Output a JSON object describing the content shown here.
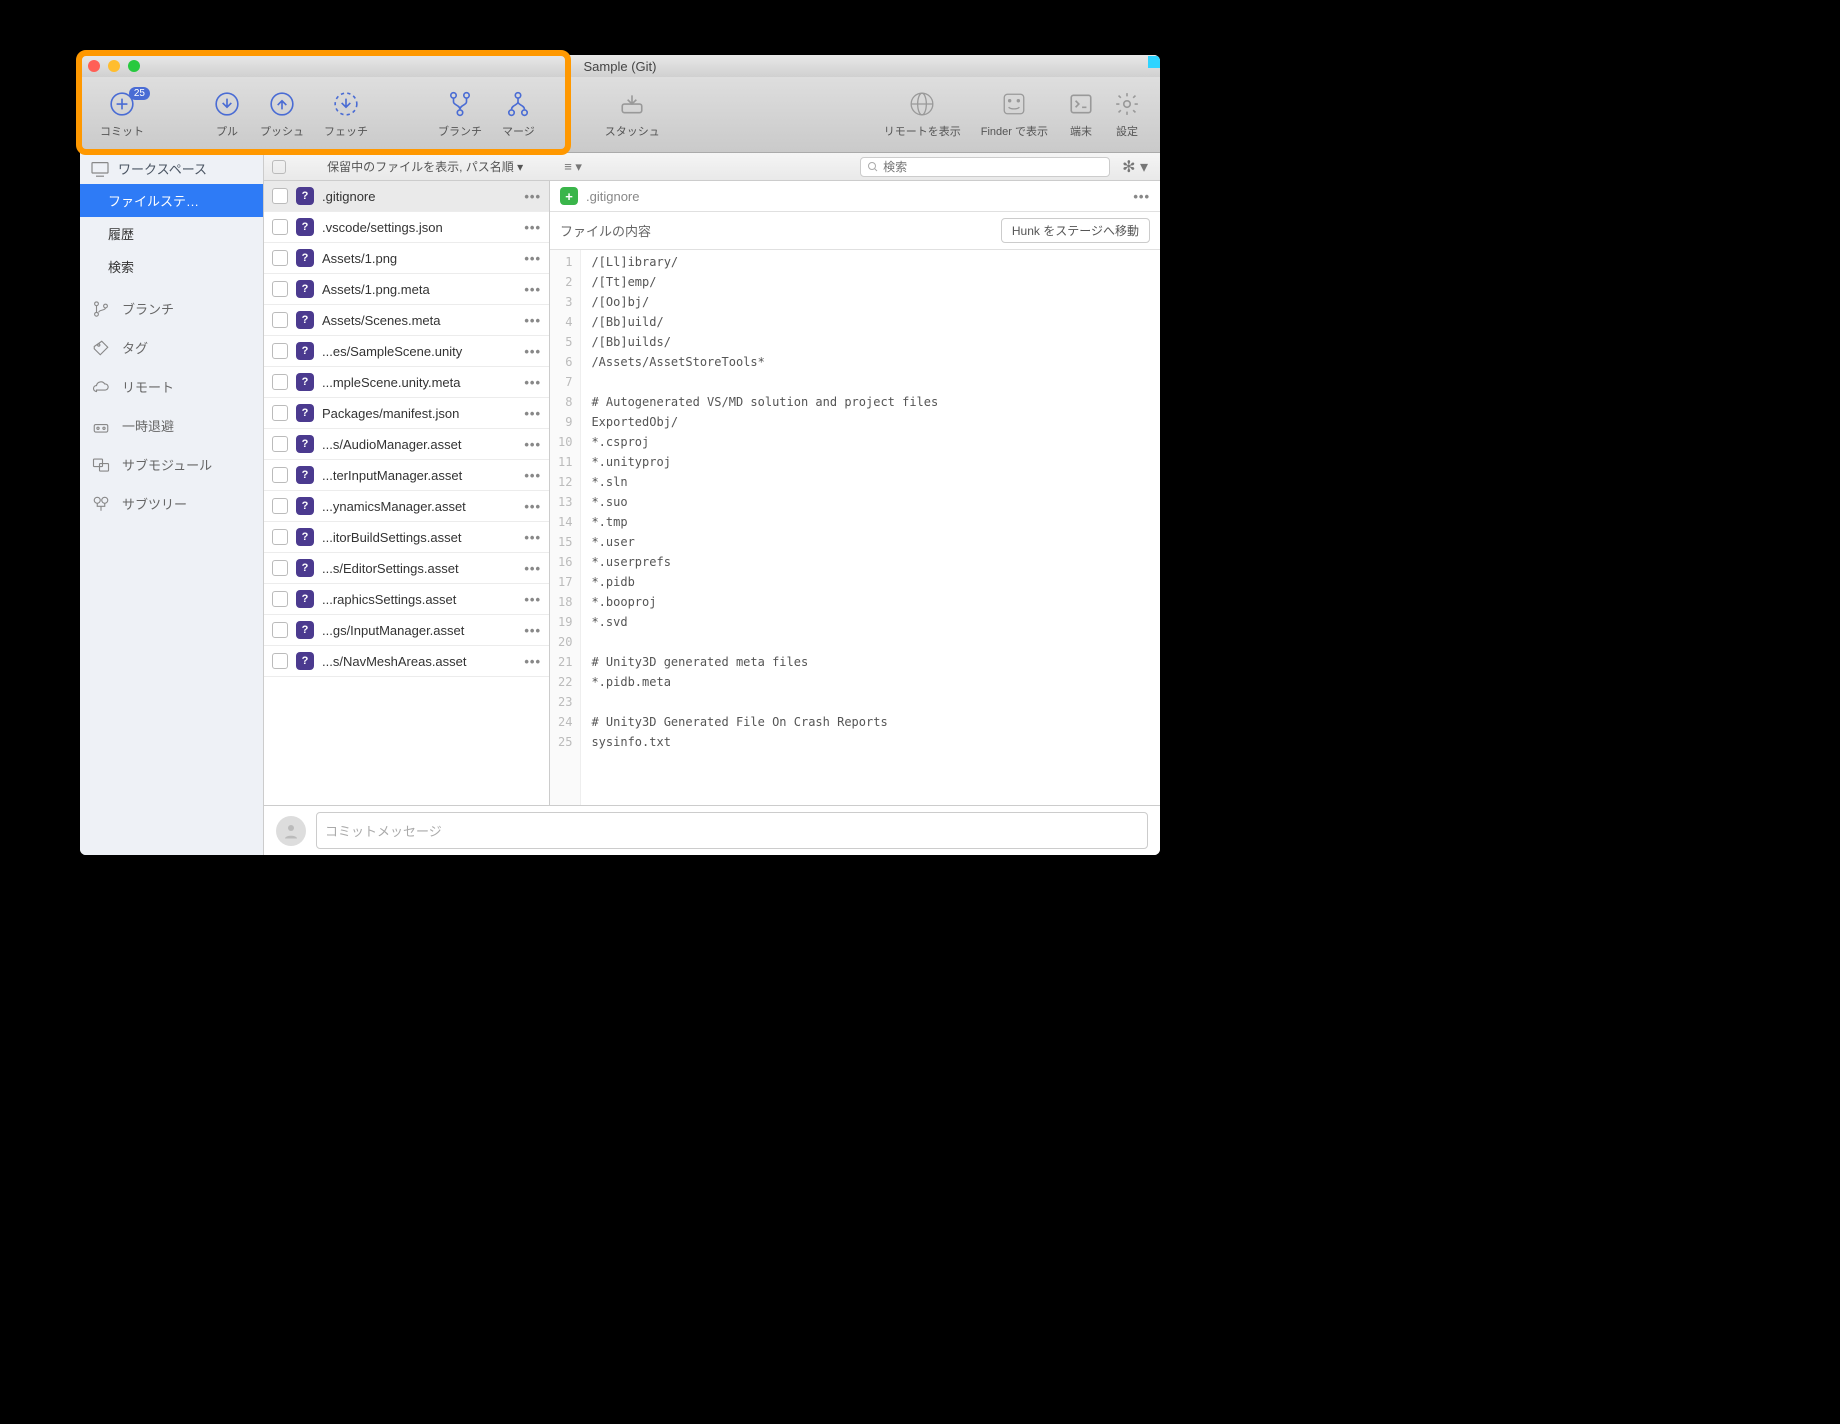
{
  "window_title": "Sample (Git)",
  "toolbar": {
    "commit": {
      "label": "コミット",
      "badge": "25"
    },
    "pull": {
      "label": "プル"
    },
    "push": {
      "label": "プッシュ"
    },
    "fetch": {
      "label": "フェッチ"
    },
    "branch": {
      "label": "ブランチ"
    },
    "merge": {
      "label": "マージ"
    },
    "stash": {
      "label": "スタッシュ"
    },
    "remote": {
      "label": "リモートを表示"
    },
    "finder": {
      "label": "Finder で表示"
    },
    "terminal": {
      "label": "端末"
    },
    "settings": {
      "label": "設定"
    }
  },
  "sidebar": {
    "workspace": "ワークスペース",
    "filestatus": "ファイルステ…",
    "history": "履歴",
    "search": "検索",
    "branches": "ブランチ",
    "tags": "タグ",
    "remotes": "リモート",
    "stashes": "一時退避",
    "submodules": "サブモジュール",
    "subtrees": "サブツリー"
  },
  "filter": {
    "dropdown": "保留中のファイルを表示, パス名順",
    "search_placeholder": "検索"
  },
  "files": [
    {
      "name": ".gitignore",
      "selected": true
    },
    {
      "name": ".vscode/settings.json"
    },
    {
      "name": "Assets/1.png"
    },
    {
      "name": "Assets/1.png.meta"
    },
    {
      "name": "Assets/Scenes.meta"
    },
    {
      "name": "...es/SampleScene.unity"
    },
    {
      "name": "...mpleScene.unity.meta"
    },
    {
      "name": "Packages/manifest.json"
    },
    {
      "name": "...s/AudioManager.asset"
    },
    {
      "name": "...terInputManager.asset"
    },
    {
      "name": "...ynamicsManager.asset"
    },
    {
      "name": "...itorBuildSettings.asset"
    },
    {
      "name": "...s/EditorSettings.asset"
    },
    {
      "name": "...raphicsSettings.asset"
    },
    {
      "name": "...gs/InputManager.asset"
    },
    {
      "name": "...s/NavMeshAreas.asset"
    }
  ],
  "diff": {
    "filename": ".gitignore",
    "content_title": "ファイルの内容",
    "hunk_button": "Hunk をステージへ移動",
    "lines": [
      "/[Ll]ibrary/",
      "/[Tt]emp/",
      "/[Oo]bj/",
      "/[Bb]uild/",
      "/[Bb]uilds/",
      "/Assets/AssetStoreTools*",
      "",
      "# Autogenerated VS/MD solution and project files",
      "ExportedObj/",
      "*.csproj",
      "*.unityproj",
      "*.sln",
      "*.suo",
      "*.tmp",
      "*.user",
      "*.userprefs",
      "*.pidb",
      "*.booproj",
      "*.svd",
      "",
      "# Unity3D generated meta files",
      "*.pidb.meta",
      "",
      "# Unity3D Generated File On Crash Reports",
      "sysinfo.txt"
    ]
  },
  "commit_msg_placeholder": "コミットメッセージ",
  "status_char": "?"
}
